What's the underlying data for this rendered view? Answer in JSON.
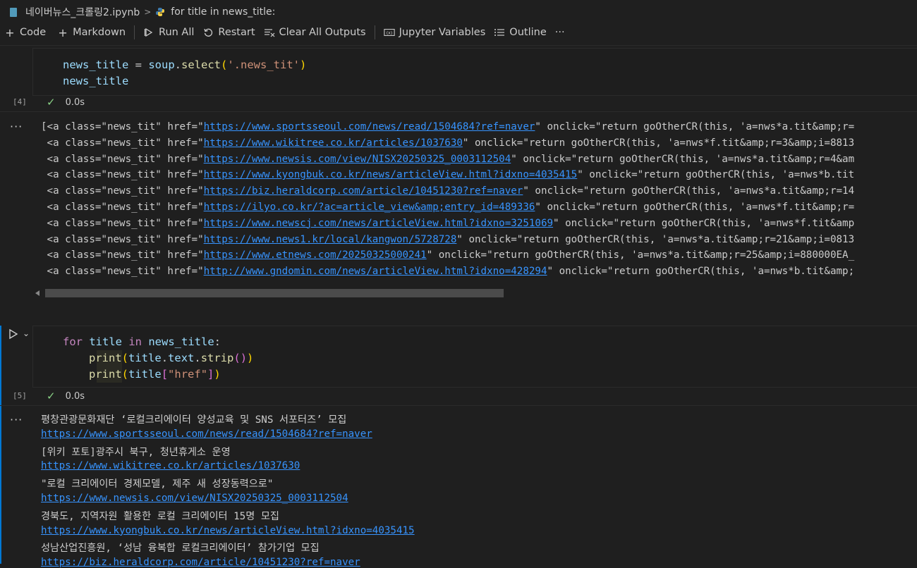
{
  "breadcrumb": {
    "file": "네이버뉴스_크롤링2.ipynb",
    "separator": ">",
    "cell": "for title in news_title:"
  },
  "toolbar": {
    "code": "Code",
    "markdown": "Markdown",
    "run_all": "Run All",
    "restart": "Restart",
    "clear_outputs": "Clear All Outputs",
    "variables": "Jupyter Variables",
    "outline": "Outline",
    "more": "···"
  },
  "cell1": {
    "exec": "[4]",
    "status_time": "0.0s",
    "code": {
      "l1_var": "news_title",
      "l1_eq": " = ",
      "l1_obj": "soup",
      "l1_dot": ".",
      "l1_fn": "select",
      "l1_open": "(",
      "l1_str": "'.news_tit'",
      "l1_close": ")",
      "l2_var": "news_title"
    },
    "output_dots": "···",
    "output": [
      {
        "prefix": "[<a class=\"news_tit\" href=\"",
        "url": "https://www.sportsseoul.com/news/read/1504684?ref=naver",
        "suffix": "\" onclick=\"return goOtherCR(this, 'a=nws*a.tit&amp;r="
      },
      {
        "prefix": " <a class=\"news_tit\" href=\"",
        "url": "https://www.wikitree.co.kr/articles/1037630",
        "suffix": "\" onclick=\"return goOtherCR(this, 'a=nws*f.tit&amp;r=3&amp;i=8813"
      },
      {
        "prefix": " <a class=\"news_tit\" href=\"",
        "url": "https://www.newsis.com/view/NISX20250325_0003112504",
        "suffix": "\" onclick=\"return goOtherCR(this, 'a=nws*a.tit&amp;r=4&am"
      },
      {
        "prefix": " <a class=\"news_tit\" href=\"",
        "url": "https://www.kyongbuk.co.kr/news/articleView.html?idxno=4035415",
        "suffix": "\" onclick=\"return goOtherCR(this, 'a=nws*b.tit"
      },
      {
        "prefix": " <a class=\"news_tit\" href=\"",
        "url": "https://biz.heraldcorp.com/article/10451230?ref=naver",
        "suffix": "\" onclick=\"return goOtherCR(this, 'a=nws*a.tit&amp;r=14"
      },
      {
        "prefix": " <a class=\"news_tit\" href=\"",
        "url": "https://ilyo.co.kr/?ac=article_view&amp;entry_id=489336",
        "suffix": "\" onclick=\"return goOtherCR(this, 'a=nws*f.tit&amp;r="
      },
      {
        "prefix": " <a class=\"news_tit\" href=\"",
        "url": "https://www.newscj.com/news/articleView.html?idxno=3251069",
        "suffix": "\" onclick=\"return goOtherCR(this, 'a=nws*f.tit&amp"
      },
      {
        "prefix": " <a class=\"news_tit\" href=\"",
        "url": "https://www.news1.kr/local/kangwon/5728728",
        "suffix": "\" onclick=\"return goOtherCR(this, 'a=nws*a.tit&amp;r=21&amp;i=0813"
      },
      {
        "prefix": " <a class=\"news_tit\" href=\"",
        "url": "https://www.etnews.com/20250325000241",
        "suffix": "\" onclick=\"return goOtherCR(this, 'a=nws*a.tit&amp;r=25&amp;i=880000EA_"
      },
      {
        "prefix": " <a class=\"news_tit\" href=\"",
        "url": "http://www.gndomin.com/news/articleView.html?idxno=428294",
        "suffix": "\" onclick=\"return goOtherCR(this, 'a=nws*b.tit&amp;"
      }
    ]
  },
  "cell2": {
    "exec": "[5]",
    "status_time": "0.0s",
    "code": {
      "l1_kw1": "for",
      "l1_var1": " title ",
      "l1_kw2": "in",
      "l1_var2": " news_title",
      "l1_colon": ":",
      "l2_fn": "print",
      "l2_open": "(",
      "l2_obj": "title",
      "l2_d1": ".",
      "l2_attr": "text",
      "l2_d2": ".",
      "l2_fn2": "strip",
      "l2_inner": "()",
      "l2_close": ")",
      "l3_fn": "print",
      "l3_open": "(",
      "l3_obj": "title",
      "l3_bo": "[",
      "l3_str": "\"href\"",
      "l3_bc": "]",
      "l3_close": ")"
    },
    "output_dots": "···",
    "output": [
      {
        "type": "text",
        "value": "평창관광문화재단 ‘로컬크리에이터 양성교육 및 SNS 서포터즈’ 모집"
      },
      {
        "type": "link",
        "value": "https://www.sportsseoul.com/news/read/1504684?ref=naver"
      },
      {
        "type": "text",
        "value": "[위키 포토]광주시 북구, 청년휴게소 운영"
      },
      {
        "type": "link",
        "value": "https://www.wikitree.co.kr/articles/1037630"
      },
      {
        "type": "text",
        "value": "\"로컬 크리에이터 경제모델, 제주 새 성장동력으로\""
      },
      {
        "type": "link",
        "value": "https://www.newsis.com/view/NISX20250325_0003112504"
      },
      {
        "type": "text",
        "value": "경북도, 지역자원 활용한 로컬 크리에이터 15명 모집"
      },
      {
        "type": "link",
        "value": "https://www.kyongbuk.co.kr/news/articleView.html?idxno=4035415"
      },
      {
        "type": "text",
        "value": "성남산업진흥원, ‘성남 융복합 로컬크리에이터’ 참가기업 모집"
      },
      {
        "type": "link",
        "value": "https://biz.heraldcorp.com/article/10451230?ref=naver"
      }
    ]
  }
}
